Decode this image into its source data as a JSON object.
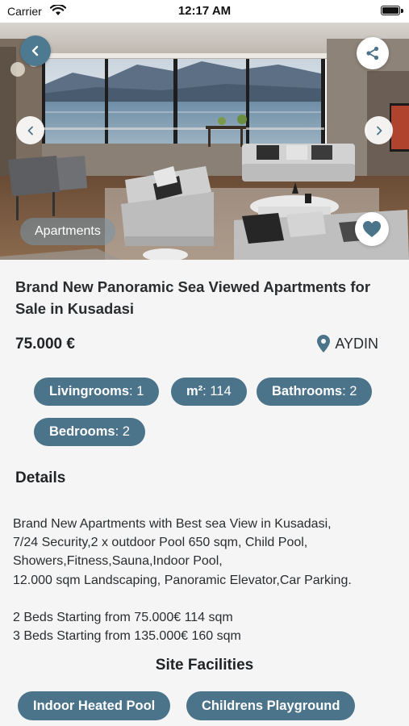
{
  "status_bar": {
    "carrier": "Carrier",
    "time": "12:17 AM",
    "battery_level": 1.0
  },
  "hero": {
    "category": "Apartments",
    "icons": {
      "back": "chevron-left-icon",
      "share": "share-icon",
      "prev": "chevron-left-icon",
      "next": "chevron-right-icon",
      "favorite": "heart-icon"
    }
  },
  "listing": {
    "title": "Brand New Panoramic Sea Viewed Apartments for Sale in Kusadasi",
    "price": "75.000 €",
    "location": "AYDIN",
    "features": [
      {
        "label": "Livingrooms",
        "sep": ":",
        "value": "1"
      },
      {
        "label": "m²",
        "sep": ":",
        "value": "114"
      },
      {
        "label": "Bathrooms",
        "sep": ":",
        "value": "2"
      },
      {
        "label": "Bedrooms",
        "sep": ":",
        "value": "2"
      }
    ]
  },
  "details": {
    "heading": "Details",
    "lines": [
      "Brand New Apartments with Best sea View in Kusadasi,",
      "7/24 Security,2 x outdoor Pool 650 sqm, Child Pool,",
      "Showers,Fitness,Sauna,Indoor Pool,",
      "12.000 sqm Landscaping, Panoramic Elevator,Car Parking.",
      "",
      "2 Beds Starting from 75.000€  114 sqm",
      "3 Beds  Starting from 135.000€  160 sqm"
    ]
  },
  "facilities": {
    "heading": "Site Facilities",
    "items": [
      "Indoor Heated Pool",
      "Childrens Playground"
    ]
  },
  "colors": {
    "accent": "#4b7389",
    "back_button": "#4d7a91",
    "background": "#f5f5f5"
  }
}
